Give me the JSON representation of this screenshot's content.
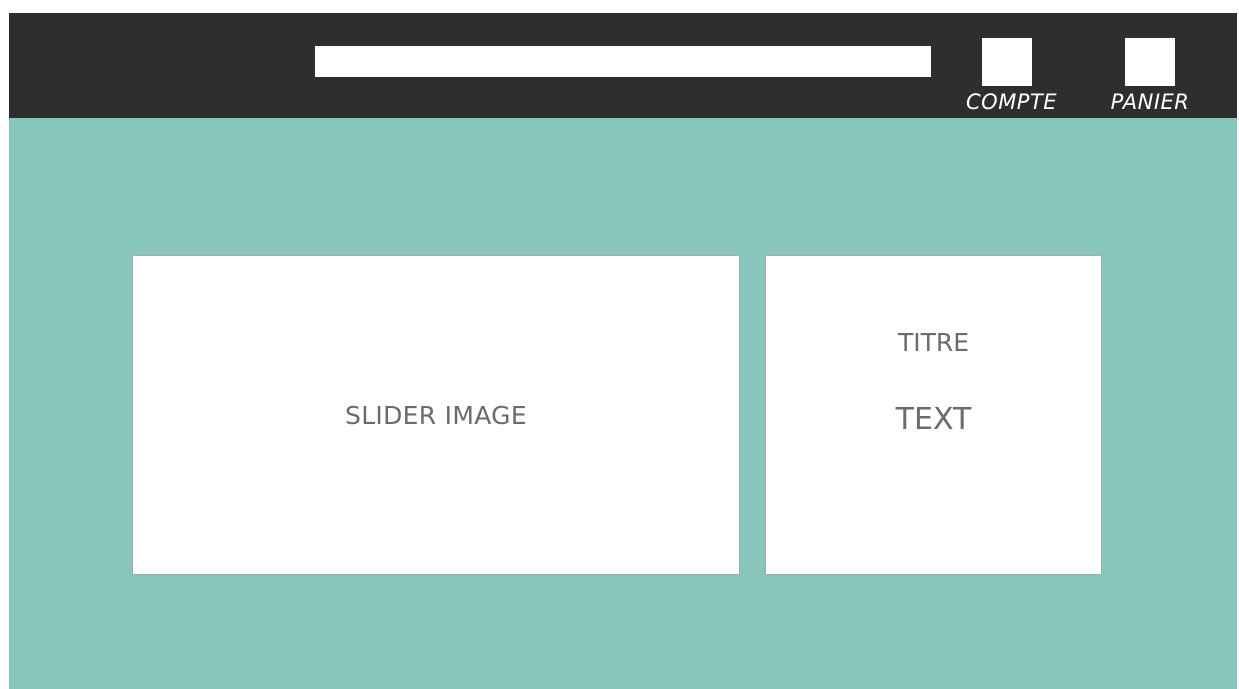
{
  "colors": {
    "header_bg": "#2e2e2e",
    "main_bg": "#88c6bb",
    "panel_bg": "#ffffff",
    "text_muted": "#6b6b6b",
    "nav_text": "#ffffff"
  },
  "header": {
    "search": {
      "value": "",
      "placeholder": ""
    },
    "nav": [
      {
        "label": "COMPTE",
        "icon": "account-icon"
      },
      {
        "label": "PANIER",
        "icon": "cart-icon"
      }
    ]
  },
  "main": {
    "slider": {
      "label": "SLIDER IMAGE"
    },
    "info": {
      "title": "TITRE",
      "text": "TEXT"
    }
  }
}
